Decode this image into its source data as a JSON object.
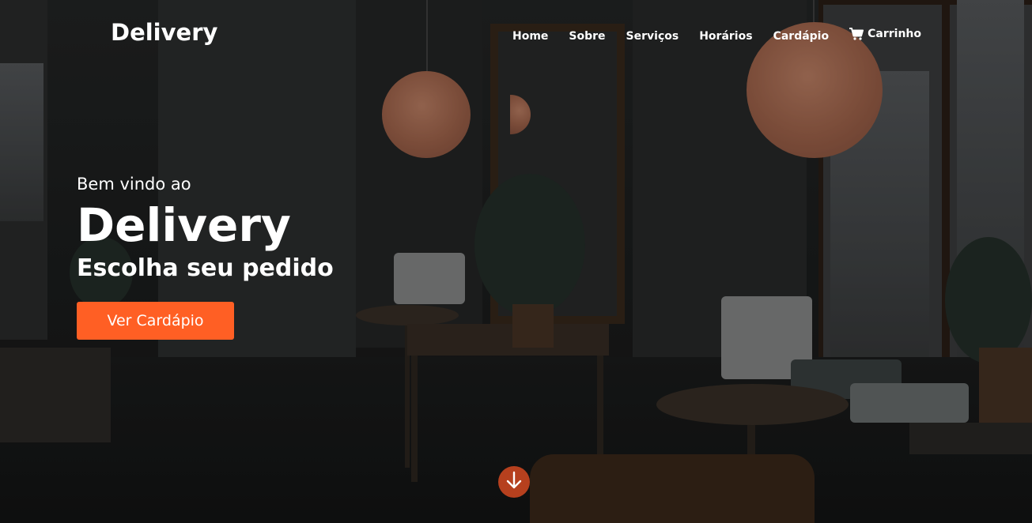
{
  "header": {
    "logo": "Delivery",
    "nav": [
      {
        "label": "Home"
      },
      {
        "label": "Sobre"
      },
      {
        "label": "Serviços"
      },
      {
        "label": "Horários"
      },
      {
        "label": "Cardápio"
      },
      {
        "label": "Carrinho",
        "icon": "cart-icon"
      }
    ]
  },
  "hero": {
    "welcome": "Bem vindo ao",
    "title": "Delivery",
    "subtitle": "Escolha seu pedido",
    "cta_label": "Ver Cardápio",
    "scroll_icon": "arrow-down-icon"
  },
  "colors": {
    "accent": "#ff5f24",
    "scroll_button": "#b6401e",
    "text": "#ffffff"
  }
}
